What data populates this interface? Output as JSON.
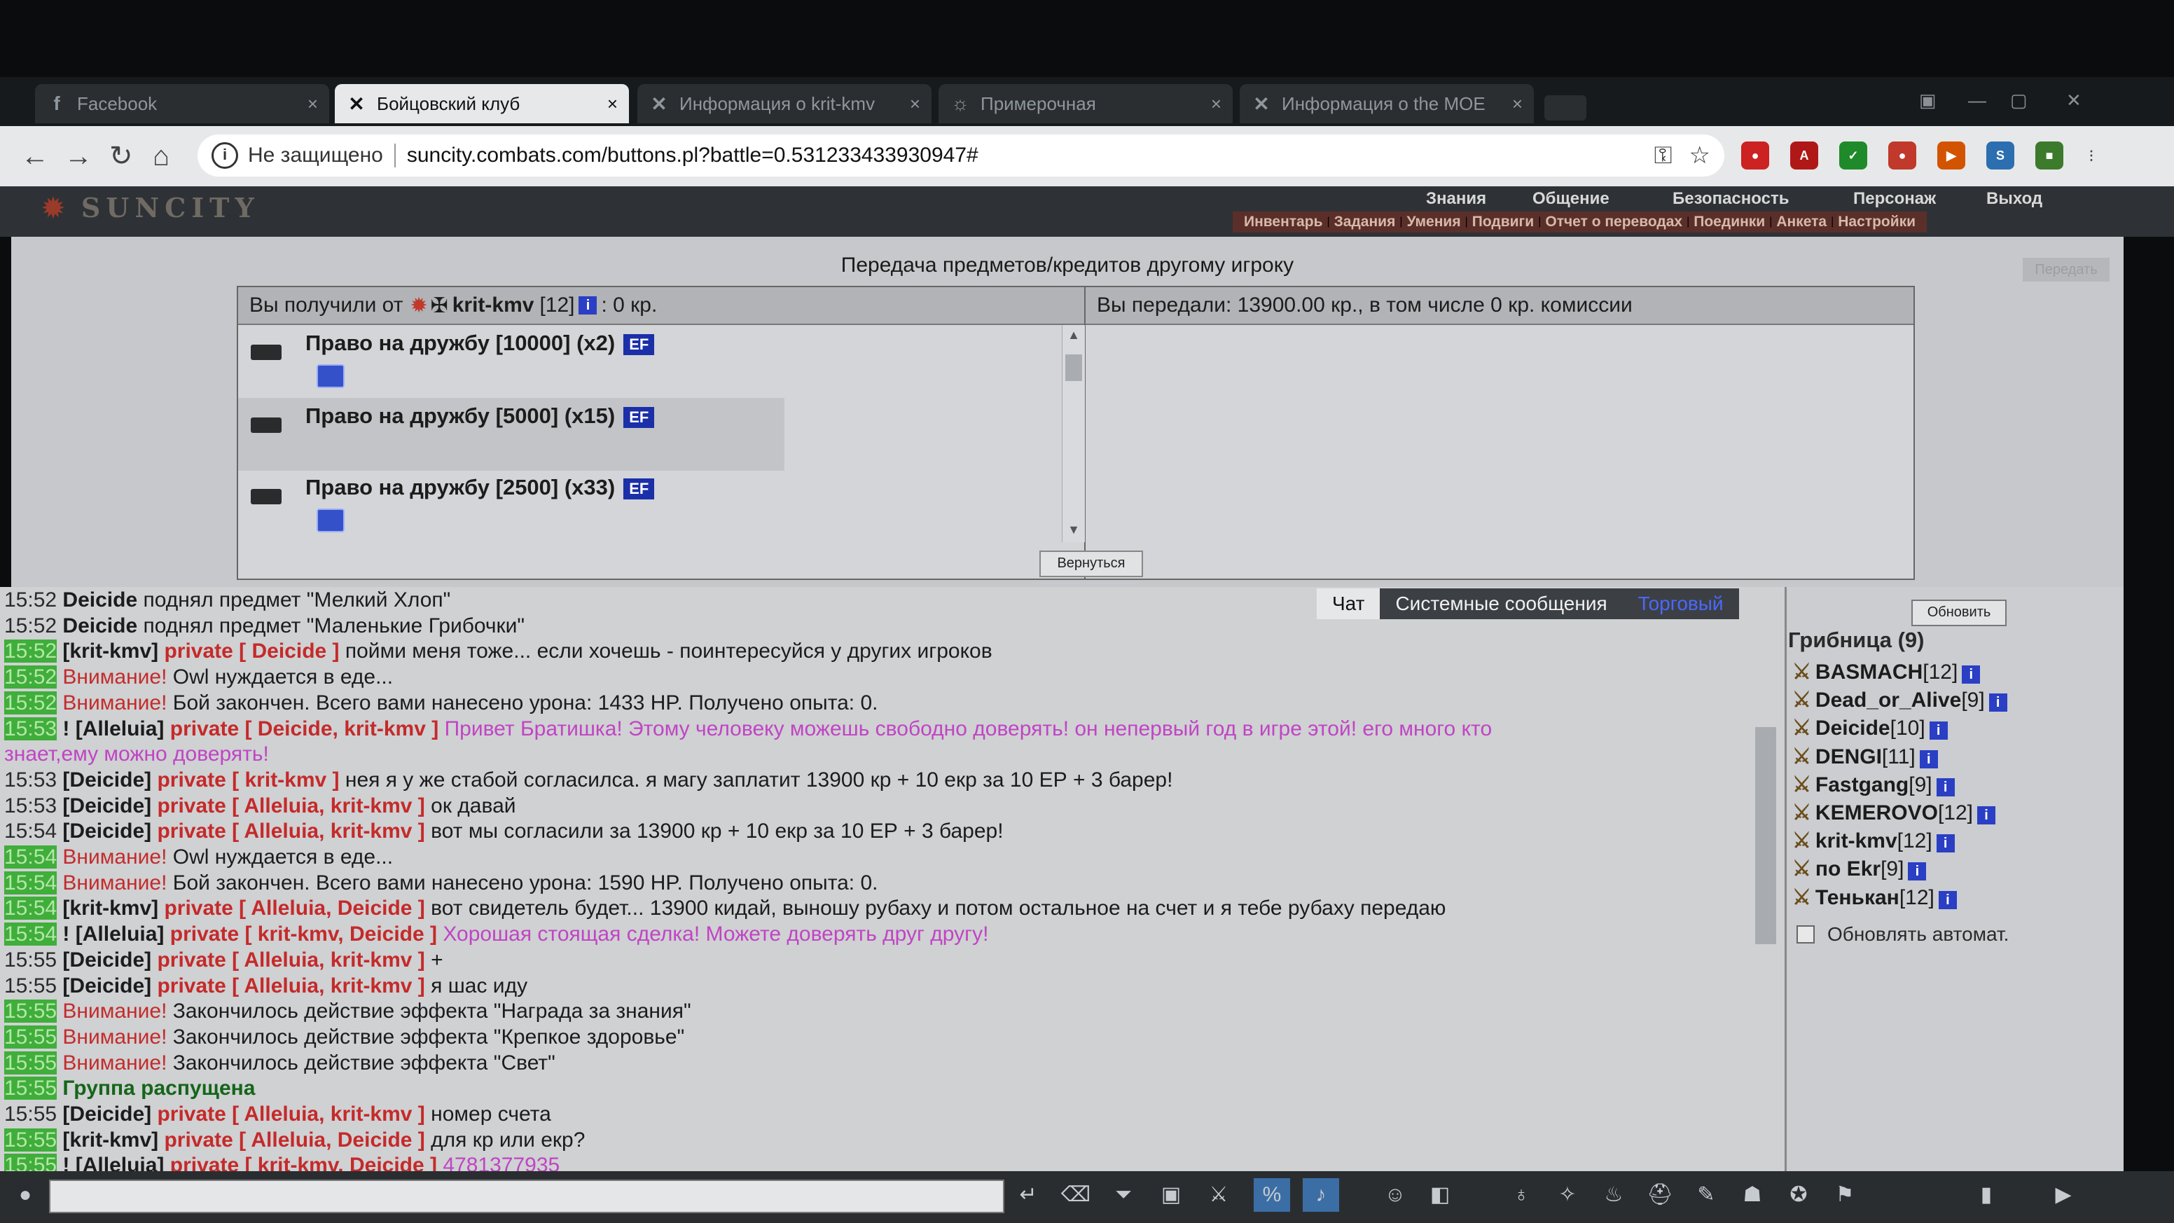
{
  "browser": {
    "tabs": [
      {
        "icon": "f",
        "label": "Facebook",
        "active": false
      },
      {
        "icon": "✕",
        "label": "Бойцовский клуб",
        "active": true
      },
      {
        "icon": "✕",
        "label": "Информация о krit-kmv",
        "active": false
      },
      {
        "icon": "☼",
        "label": "Примерочная",
        "active": false
      },
      {
        "icon": "✕",
        "label": "Информация о the MOE",
        "active": false
      }
    ],
    "close_glyph": "×",
    "security_label": "Не защищено",
    "url": "suncity.combats.com/buttons.pl?battle=0.531233433930947#"
  },
  "site": {
    "logo": "SUNCITY",
    "menu": [
      "Знания",
      "Общение",
      "Безопасность",
      "Персонаж",
      "Выход"
    ],
    "submenu": [
      "Инвентарь",
      "Задания",
      "Умения",
      "Подвиги",
      "Отчет о переводах",
      "Поединки",
      "Анкета",
      "Настройки"
    ]
  },
  "transfer": {
    "title": "Передача предметов/кредитов другому игроку",
    "corner_button": "Передать",
    "received_prefix": "Вы получили от",
    "received_from": "krit-kmv",
    "received_level": "[12]",
    "received_amount": ": 0 кр.",
    "sent_text": "Вы передали: 13900.00 кр., в том числе 0 кр. комиссии",
    "items": [
      {
        "name": "Право на дружбу [10000] (x2)",
        "badge": "EF"
      },
      {
        "name": "Право на дружбу [5000] (x15)",
        "badge": "EF"
      },
      {
        "name": "Право на дружбу [2500] (x33)",
        "badge": "EF"
      }
    ],
    "back_button": "Вернуться"
  },
  "chat": {
    "tabs": [
      "Чат",
      "Системные сообщения",
      "Торговый"
    ],
    "lines": [
      {
        "ts": "15:52",
        "hl": false,
        "nick": "Deicide",
        "priv": "",
        "text": " поднял предмет \"Мелкий Хлоп\"",
        "style": "plain"
      },
      {
        "ts": "15:52",
        "hl": false,
        "nick": "Deicide",
        "priv": "",
        "text": " поднял предмет \"Маленькие Грибочки\"",
        "style": "plain"
      },
      {
        "ts": "15:52",
        "hl": true,
        "nick": "[krit-kmv]",
        "priv": " private [ Deicide ] ",
        "text": "пойми меня тоже... если хочешь - поинтересуйся у других игроков",
        "style": "plain"
      },
      {
        "ts": "15:52",
        "hl": true,
        "nick": "",
        "priv": "",
        "text": "Внимание! Owl нуждается в еде...",
        "style": "warn"
      },
      {
        "ts": "15:52",
        "hl": true,
        "nick": "",
        "priv": "",
        "text": "Внимание! Бой закончен. Всего вами нанесено урона: 1433 HP. Получено опыта: 0.",
        "style": "warn"
      },
      {
        "ts": "15:53",
        "hl": true,
        "nick": "! [Alleluia]",
        "priv": " private [ Deicide, krit-kmv ] ",
        "text": "Привет Братишка! Этому человеку можешь свободно доверять! он непервый год в игре этой! его много кто",
        "style": "pink"
      },
      {
        "ts": "",
        "hl": false,
        "nick": "",
        "priv": "",
        "text": "знает,ему можно доверять!",
        "style": "pink"
      },
      {
        "ts": "15:53",
        "hl": false,
        "nick": "[Deicide]",
        "priv": " private [ krit-kmv ] ",
        "text": "нея я у же стабой согласилса. я магу заплатит 13900 кр + 10 екр за 10 ЕР + 3 барер!",
        "style": "plain"
      },
      {
        "ts": "15:53",
        "hl": false,
        "nick": "[Deicide]",
        "priv": " private [ Alleluia, krit-kmv ] ",
        "text": "ок давай",
        "style": "plain"
      },
      {
        "ts": "15:54",
        "hl": false,
        "nick": "[Deicide]",
        "priv": " private [ Alleluia, krit-kmv ] ",
        "text": "вот мы согласили за 13900 кр + 10 екр за 10 ЕР + 3 барер!",
        "style": "plain"
      },
      {
        "ts": "15:54",
        "hl": true,
        "nick": "",
        "priv": "",
        "text": "Внимание! Owl нуждается в еде...",
        "style": "warn"
      },
      {
        "ts": "15:54",
        "hl": true,
        "nick": "",
        "priv": "",
        "text": "Внимание! Бой закончен. Всего вами нанесено урона: 1590 HP. Получено опыта: 0.",
        "style": "warn"
      },
      {
        "ts": "15:54",
        "hl": true,
        "nick": "[krit-kmv]",
        "priv": " private [ Alleluia, Deicide ] ",
        "text": "вот свидетель будет... 13900 кидай, выношу рубаху и потом остальное на счет и я тебе рубаху передаю",
        "style": "plain"
      },
      {
        "ts": "15:54",
        "hl": true,
        "nick": "! [Alleluia]",
        "priv": " private [ krit-kmv, Deicide ] ",
        "text": "Хорошая стоящая сделка! Можете доверять друг другу!",
        "style": "pink"
      },
      {
        "ts": "15:55",
        "hl": false,
        "nick": "[Deicide]",
        "priv": " private [ Alleluia, krit-kmv ] ",
        "text": "+",
        "style": "plain"
      },
      {
        "ts": "15:55",
        "hl": false,
        "nick": "[Deicide]",
        "priv": " private [ Alleluia, krit-kmv ] ",
        "text": "я шас иду",
        "style": "plain"
      },
      {
        "ts": "15:55",
        "hl": true,
        "nick": "",
        "priv": "",
        "text": "Внимание! Закончилось действие эффекта \"Награда за знания\"",
        "style": "warn"
      },
      {
        "ts": "15:55",
        "hl": true,
        "nick": "",
        "priv": "",
        "text": "Внимание! Закончилось действие эффекта \"Крепкое здоровье\"",
        "style": "warn"
      },
      {
        "ts": "15:55",
        "hl": true,
        "nick": "",
        "priv": "",
        "text": "Внимание! Закончилось действие эффекта \"Свет\"",
        "style": "warn"
      },
      {
        "ts": "15:55",
        "hl": true,
        "nick": "",
        "priv": "",
        "text": "Группа распущена",
        "style": "group"
      },
      {
        "ts": "15:55",
        "hl": false,
        "nick": "[Deicide]",
        "priv": " private [ Alleluia, krit-kmv ] ",
        "text": "номер счета",
        "style": "plain"
      },
      {
        "ts": "15:55",
        "hl": true,
        "nick": "[krit-kmv]",
        "priv": " private [ Alleluia, Deicide ] ",
        "text": "для кр или екр?",
        "style": "plain"
      },
      {
        "ts": "15:55",
        "hl": true,
        "nick": "! [Alleluia]",
        "priv": " private [ krit-kmv, Deicide ] ",
        "text": "4781377935",
        "style": "pink"
      }
    ]
  },
  "online": {
    "refresh_button": "Обновить",
    "room": "Грибница (9)",
    "users": [
      {
        "name": "BASMACH",
        "level": "[12]"
      },
      {
        "name": "Dead_or_Alive",
        "level": "[9]"
      },
      {
        "name": "Deicide",
        "level": "[10]"
      },
      {
        "name": "DENGI",
        "level": "[11]"
      },
      {
        "name": "Fastgang",
        "level": "[9]"
      },
      {
        "name": "KEMEROVO",
        "level": "[12]"
      },
      {
        "name": "krit-kmv",
        "level": "[12]"
      },
      {
        "name": "по Ekr",
        "level": "[9]"
      },
      {
        "name": "Тенькан",
        "level": "[12]"
      }
    ],
    "info_glyph": "i",
    "auto_refresh_label": "Обновлять автомат."
  },
  "colors": {
    "private": "#c52a2a",
    "pink_msg": "#c144c4",
    "timestamp_hl": "#3fae3a",
    "info_icon": "#2a3fc4"
  }
}
